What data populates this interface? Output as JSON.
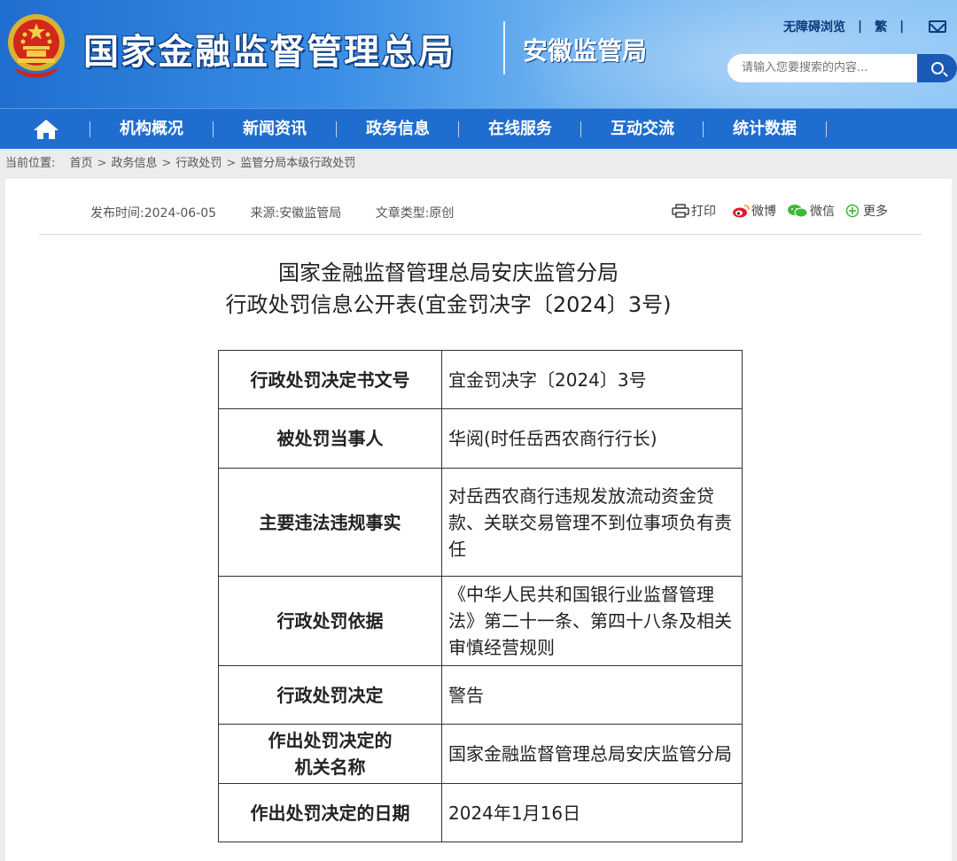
{
  "header": {
    "site_title": "国家金融监督管理总局",
    "sub_title": "安徽监管局",
    "accessibility_link": "无障碍浏览",
    "traditional_link": "繁",
    "search_placeholder": "请输入您要搜索的内容...",
    "icons": [
      "national-emblem-icon",
      "mail-icon",
      "search-icon"
    ],
    "colors": {
      "header_blue": "#1f6ecf",
      "nav_blue": "#1f6ecf",
      "title_outline": "#0c3f86"
    }
  },
  "nav": {
    "items": [
      "机构概况",
      "新闻资讯",
      "政务信息",
      "在线服务",
      "互动交流",
      "统计数据"
    ]
  },
  "breadcrumb": {
    "label": "当前位置:",
    "items": [
      "首页",
      "政务信息",
      "行政处罚",
      "监管分局本级行政处罚"
    ]
  },
  "article": {
    "publish_time": "发布时间:2024-06-05",
    "source": "来源:安徽监管局",
    "doc_type": "文章类型:原创",
    "share": {
      "print": "打印",
      "weibo": "微博",
      "wechat": "微信",
      "more": "更多"
    },
    "title_line1": "国家金融监督管理总局安庆监管分局",
    "title_line2": "行政处罚信息公开表(宜金罚决字〔2024〕3号)"
  },
  "table": {
    "rows": [
      {
        "key": "行政处罚决定书文号",
        "value": "宜金罚决字〔2024〕3号"
      },
      {
        "key": "被处罚当事人",
        "value": "华阅(时任岳西农商行行长)"
      },
      {
        "key": "主要违法违规事实",
        "value": "对岳西农商行违规发放流动资金贷款、关联交易管理不到位事项负有责任"
      },
      {
        "key": "行政处罚依据",
        "value": "《中华人民共和国银行业监督管理法》第二十一条、第四十八条及相关审慎经营规则"
      },
      {
        "key": "行政处罚决定",
        "value": "警告"
      },
      {
        "key_line1": "作出处罚决定的",
        "key_line2": "机关名称",
        "value": "国家金融监督管理总局安庆监管分局"
      },
      {
        "key": "作出处罚决定的日期",
        "value": "2024年1月16日"
      }
    ]
  }
}
